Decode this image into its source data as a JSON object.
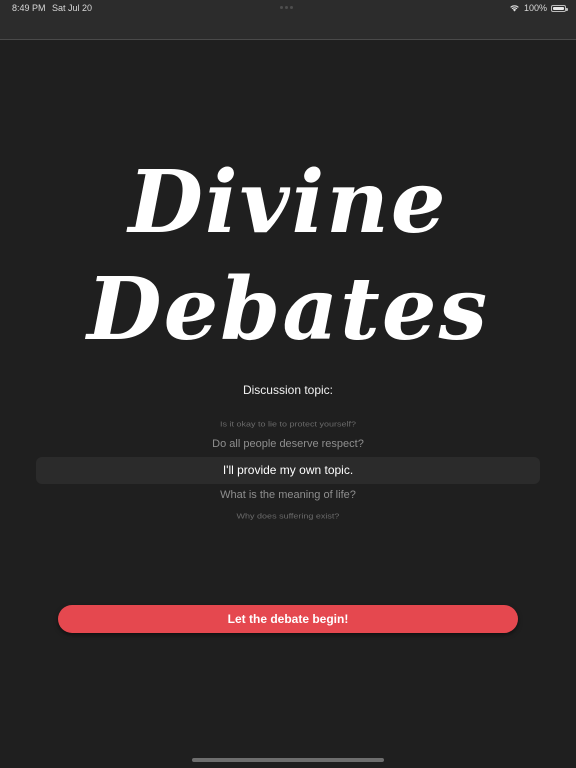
{
  "status_bar": {
    "time": "8:49 PM",
    "date": "Sat Jul 20",
    "battery_text": "100%",
    "battery_level": 1.0
  },
  "app": {
    "title_line1": "Divine",
    "title_line2": "Debates"
  },
  "topic_picker": {
    "label": "Discussion topic:",
    "items": [
      "Is it okay to lie to protect yourself?",
      "Do all people deserve respect?",
      "I'll provide my own topic.",
      "What is the meaning of life?",
      "Why does suffering exist?"
    ],
    "selected_index": 2
  },
  "start_button": {
    "label": "Let the debate begin!"
  },
  "colors": {
    "background": "#1f1f1f",
    "accent": "#e5484f",
    "text": "#ffffff"
  },
  "icons": {
    "wifi": "wifi-icon",
    "battery": "battery-icon"
  }
}
